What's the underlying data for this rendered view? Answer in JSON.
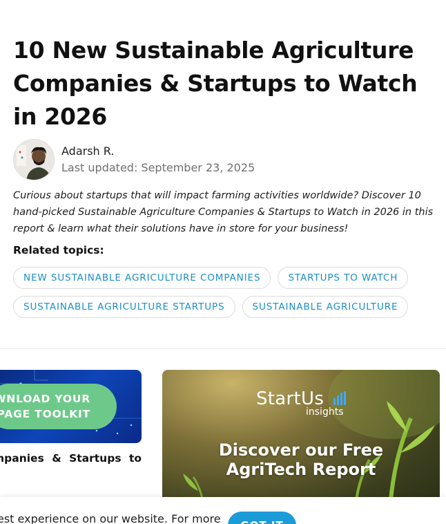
{
  "article": {
    "title": "10 New Sustainable Agriculture Companies & Startups to Watch in 2026",
    "author": {
      "name": "Adarsh R.",
      "updated": "Last updated: September 23, 2025"
    },
    "intro": "Curious about startups that will impact farming activities worldwide? Discover 10 hand-picked Sustainable Agriculture Companies & Startups to Watch in 2026 in this report & learn what their solutions have in store for your business!",
    "related_label": "Related topics:",
    "tags": [
      "New Sustainable Agriculture Companies",
      "Startups to Watch",
      "Sustainable Agriculture Startups",
      "Sustainable Agriculture"
    ]
  },
  "toolkit_card": {
    "cta_line1": "WNLOAD YOUR",
    "cta_line2": "PAGE TOOLKIT",
    "caption": "mpanies & Startups to"
  },
  "report_card": {
    "brand_name": "StartUs",
    "brand_sub": "insights",
    "promo_line1": "Discover our Free",
    "promo_line2": "AgriTech Report"
  },
  "cookie": {
    "text": "est experience on our website. For more",
    "button": "GOT IT"
  },
  "colors": {
    "tag_text": "#1a8fc8",
    "cta_green": "#6dc98a",
    "cookie_button": "#1b9bd8",
    "card_blue": "#0e45b8"
  }
}
